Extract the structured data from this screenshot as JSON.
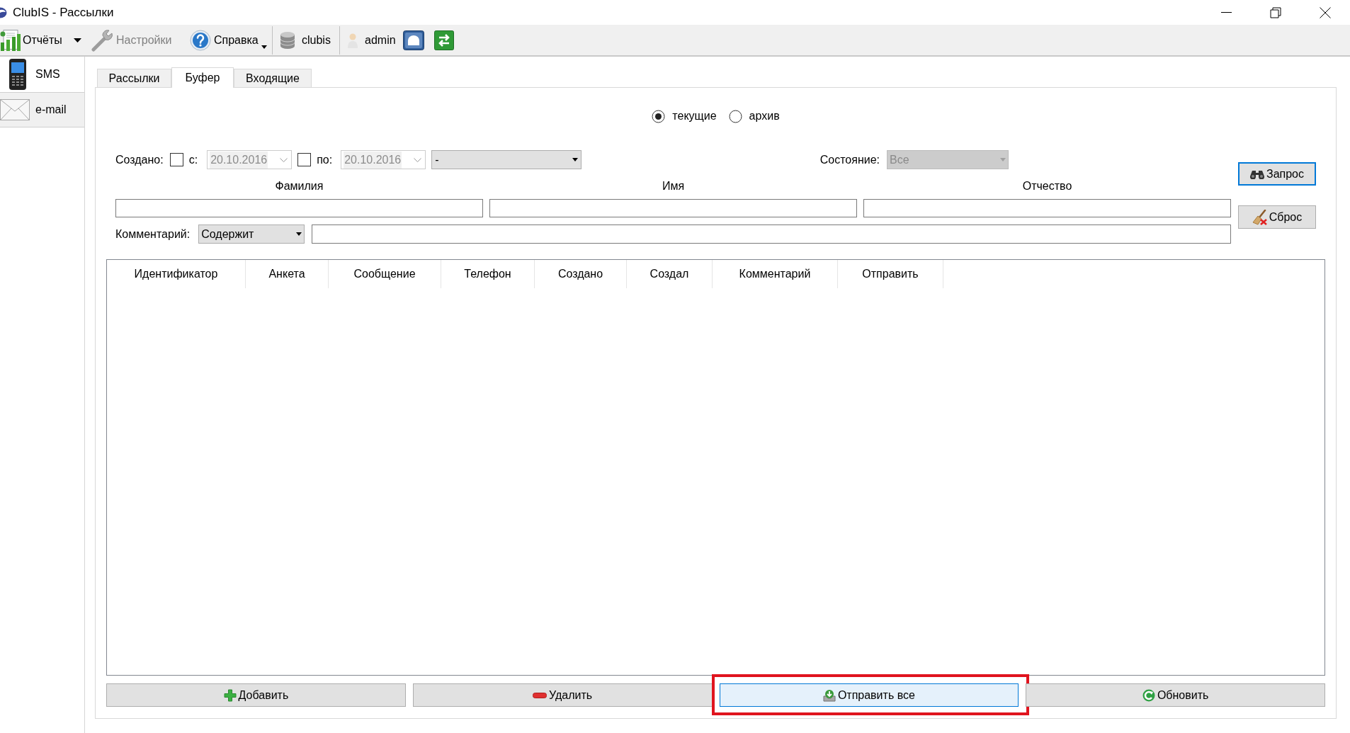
{
  "window": {
    "title": "ClubIS - Рассылки"
  },
  "toolbar": {
    "reports": {
      "label": "Отчёты",
      "disabled": false
    },
    "settings": {
      "label": "Настройки",
      "disabled": true
    },
    "help": {
      "label": "Справка",
      "disabled": false
    },
    "database": {
      "label": "clubis"
    },
    "user": {
      "label": "admin"
    }
  },
  "sidebar": {
    "items": [
      {
        "kind": "sms",
        "label": "SMS",
        "selected": true
      },
      {
        "kind": "email",
        "label": "e-mail",
        "selected": false
      }
    ]
  },
  "tabs": [
    {
      "label": "Рассылки",
      "selected": false
    },
    {
      "label": "Буфер",
      "selected": true
    },
    {
      "label": "Входящие",
      "selected": false
    }
  ],
  "filters": {
    "mode": [
      {
        "label": "текущие",
        "selected": true
      },
      {
        "label": "архив",
        "selected": false
      }
    ],
    "created": {
      "label": "Создано:",
      "from": {
        "label": "с:",
        "checked": false,
        "value": "20.10.2016"
      },
      "to": {
        "label": "по:",
        "checked": false,
        "value": "20.10.2016"
      },
      "period": {
        "value": "-"
      }
    },
    "status": {
      "label": "Состояние:",
      "value": "Все",
      "disabled": true
    },
    "name_fields": [
      {
        "label": "Фамилия"
      },
      {
        "label": "Имя"
      },
      {
        "label": "Отчество"
      }
    ],
    "comment": {
      "label": "Комментарий:",
      "operator": "Содержит"
    },
    "query_button": {
      "label": "Запрос",
      "focused": true
    },
    "reset_button": {
      "label": "Сброс"
    }
  },
  "table": {
    "columns": [
      "Идентификатор",
      "Анкета",
      "Сообщение",
      "Телефон",
      "Создано",
      "Создал",
      "Комментарий",
      "Отправить"
    ]
  },
  "actions": [
    {
      "kind": "add",
      "label": "Добавить",
      "highlighted": false
    },
    {
      "kind": "delete",
      "label": "Удалить",
      "highlighted": false
    },
    {
      "kind": "send",
      "label": "Отправить все",
      "highlighted": true
    },
    {
      "kind": "refresh",
      "label": "Обновить",
      "highlighted": false
    }
  ]
}
